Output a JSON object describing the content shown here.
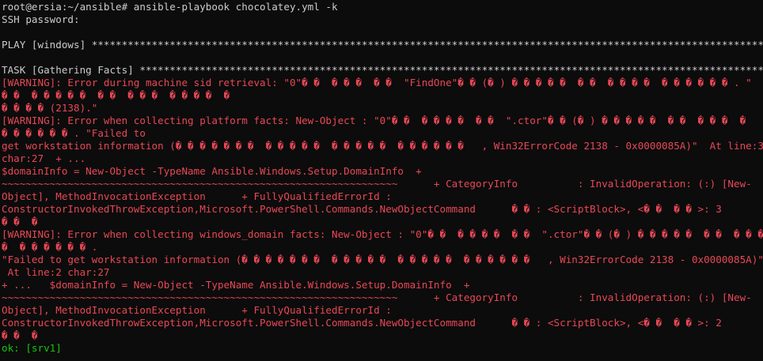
{
  "terminal": {
    "colors": {
      "background": "#0c0c0c",
      "default": "#cccccc",
      "warn": "#e74856",
      "ok": "#16c60c"
    },
    "lines": [
      {
        "text": "root@ersia:~/ansible# ansible-playbook chocolatey.yml -k",
        "color": "default"
      },
      {
        "text": "SSH password:",
        "color": "default"
      },
      {
        "text": "",
        "color": "default"
      },
      {
        "text": "PLAY [windows] ******************************************************************************************************************",
        "color": "default"
      },
      {
        "text": "",
        "color": "default"
      },
      {
        "text": "TASK [Gathering Facts] **********************************************************************************************************",
        "color": "default"
      },
      {
        "text": "[WARNING]: Error during machine sid retrieval: \"0\"� �  � � �  � �  \"FindOne\"� � (� ) � � � � �  � �  � � � �  � � � � � � . \"",
        "color": "warn"
      },
      {
        "text": "� �  � � � � �  � �  � � �  � � � �  �",
        "color": "warn"
      },
      {
        "text": "� � � � (2138).\"",
        "color": "warn"
      },
      {
        "text": "[WARNING]: Error when collecting platform facts: New-Object : \"0\"� �  � � � �  � �  \".ctor\"� � (� ) � � � � �  � �  � � �  �",
        "color": "warn"
      },
      {
        "text": "� � � � � � . \"Failed to",
        "color": "warn"
      },
      {
        "text": "get workstation information (� � � � � � �  � � � � �  � � � � �  � � � � � �   , Win32ErrorCode 2138 - 0x0000085A)\"  At line:3",
        "color": "warn"
      },
      {
        "text": "char:27  + ...",
        "color": "warn"
      },
      {
        "text": "$domainInfo = New-Object -TypeName Ansible.Windows.Setup.DomainInfo  +",
        "color": "warn"
      },
      {
        "text": "~~~~~~~~~~~~~~~~~~~~~~~~~~~~~~~~~~~~~~~~~~~~~~~~~~~~~~~~~~~~~~~~~~      + CategoryInfo          : InvalidOperation: (:) [New-",
        "color": "warn"
      },
      {
        "text": "Object], MethodInvocationException      + FullyQualifiedErrorId :",
        "color": "warn"
      },
      {
        "text": "ConstructorInvokedThrowException,Microsoft.PowerShell.Commands.NewObjectCommand      � � : <ScriptBlock>, <� �  � � >: 3",
        "color": "warn"
      },
      {
        "text": "� �  �",
        "color": "warn"
      },
      {
        "text": "[WARNING]: Error when collecting windows_domain facts: New-Object : \"0\"� �  � � � �  � �  \".ctor\"� � (� ) � � � � �  � �  � � �",
        "color": "warn"
      },
      {
        "text": "�  � � � � � � .",
        "color": "warn"
      },
      {
        "text": "\"Failed to get workstation information (� � � � � � �  � � � � �  � � � � �  � � � � � �   , Win32ErrorCode 2138 - 0x0000085A)\"",
        "color": "warn"
      },
      {
        "text": " At line:2 char:27",
        "color": "warn"
      },
      {
        "text": "+ ...   $domainInfo = New-Object -TypeName Ansible.Windows.Setup.DomainInfo  +",
        "color": "warn"
      },
      {
        "text": "~~~~~~~~~~~~~~~~~~~~~~~~~~~~~~~~~~~~~~~~~~~~~~~~~~~~~~~~~~~~~~~~~~      + CategoryInfo          : InvalidOperation: (:) [New-",
        "color": "warn"
      },
      {
        "text": "Object], MethodInvocationException      + FullyQualifiedErrorId :",
        "color": "warn"
      },
      {
        "text": "ConstructorInvokedThrowException,Microsoft.PowerShell.Commands.NewObjectCommand      � � : <ScriptBlock>, <� �  � � >: 2",
        "color": "warn"
      },
      {
        "text": "� �  �",
        "color": "warn"
      },
      {
        "text": "ok: [srv1]",
        "color": "ok"
      }
    ]
  }
}
